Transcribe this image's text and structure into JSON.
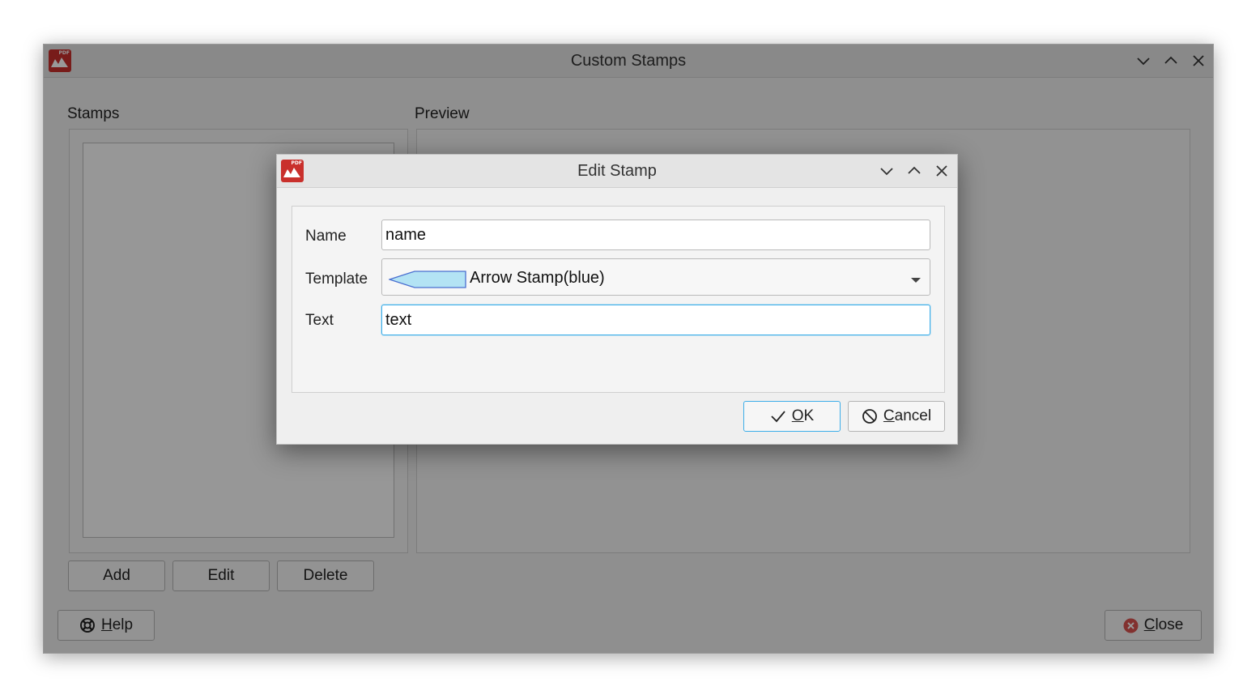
{
  "main_window": {
    "title": "Custom Stamps",
    "stamps_label": "Stamps",
    "preview_label": "Preview",
    "buttons": {
      "add": "Add",
      "edit": "Edit",
      "delete": "Delete",
      "help_mnemonic": "H",
      "help_rest": "elp",
      "close_mnemonic": "C",
      "close_rest": "lose"
    }
  },
  "dialog": {
    "title": "Edit Stamp",
    "fields": {
      "name_label": "Name",
      "name_value": "name",
      "template_label": "Template",
      "template_value": "Arrow Stamp(blue)",
      "text_label": "Text",
      "text_value": "text"
    },
    "buttons": {
      "ok_mnemonic": "O",
      "ok_rest": "K",
      "cancel_mnemonic": "C",
      "cancel_rest": "ancel"
    }
  },
  "icons": {
    "app": "app-logo-icon",
    "minimize": "chevron-down-icon",
    "maximize": "chevron-up-icon",
    "close": "close-icon",
    "help": "lifebuoy-icon",
    "close_button": "close-circle-icon",
    "ok": "checkmark-icon",
    "cancel": "cancel-icon",
    "dropdown": "dropdown-arrow-icon",
    "template_preview": "arrow-stamp-icon"
  },
  "colors": {
    "app_icon": "#c9302c",
    "focus_border": "#3daee9",
    "ok_border": "#3daee9",
    "arrow_stamp_fill": "#b3e3f4",
    "close_icon": "#d9534f"
  }
}
